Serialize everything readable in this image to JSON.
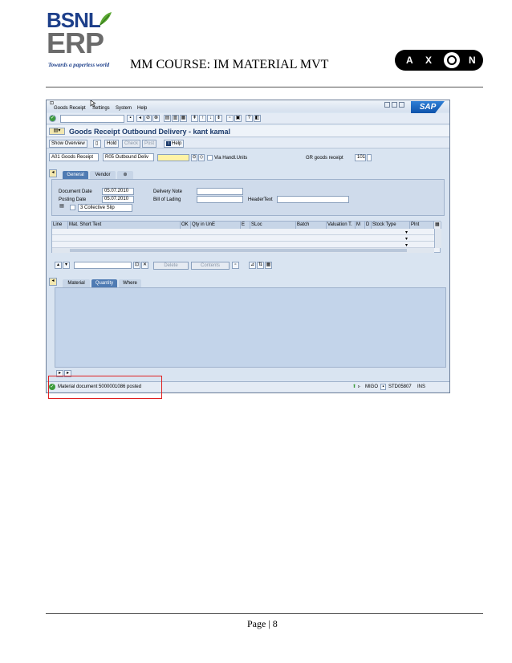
{
  "header": {
    "logo_bsnl": "BSNL",
    "logo_erp": "ERP",
    "logo_tagline": "Towards a paperless world",
    "course_title": "MM COURSE: IM MATERIAL  MVT",
    "axon_letters": [
      "A",
      "X",
      "N"
    ]
  },
  "sap": {
    "menu": [
      "Goods Receipt",
      "Settings",
      "System",
      "Help"
    ],
    "title": "Goods Receipt Outbound Delivery - kant kamal",
    "app_buttons": {
      "show_overview": "Show Overview",
      "hold": "Hold",
      "check": "Check",
      "post": "Post",
      "help": "Help"
    },
    "action_select": "A01 Goods Receipt",
    "reference_select": "R05 Outbound Deliv",
    "via_handl_units": "Via Handl.Units",
    "gr_goods_receipt_label": "GR goods receipt",
    "gr_goods_receipt_value": "101",
    "tabs_header": [
      "General",
      "Vendor"
    ],
    "general": {
      "document_date_label": "Document Date",
      "document_date": "05.07.2010",
      "posting_date_label": "Posting Date",
      "posting_date": "05.07.2010",
      "delivery_note_label": "Delivery Note",
      "bill_of_lading_label": "Bill of Lading",
      "header_text_label": "HeaderText",
      "slip_select": "3 Collective Slip"
    },
    "grid_columns": [
      "Line",
      "Mat. Short Text",
      "OK",
      "Qty in UnE",
      "E",
      "SLoc",
      "Batch",
      "Valuation T.",
      "M",
      "D",
      "Stock Type",
      "Plnt"
    ],
    "item_buttons": {
      "delete": "Delete",
      "contents": "Contents"
    },
    "tabs_detail": [
      "Material",
      "Quantity",
      "Where"
    ],
    "status_message": "Material document 5000001086 posted",
    "status_right": {
      "transaction": "MIGO",
      "server": "STD05807",
      "mode": "INS"
    }
  },
  "colors": {
    "sap_bg": "#d9e4f1",
    "tab_active": "#4f7bb3",
    "highlight_box": "#e02020",
    "input_yellow": "#fff3a6"
  },
  "footer": {
    "page_label": "Page | 8"
  }
}
